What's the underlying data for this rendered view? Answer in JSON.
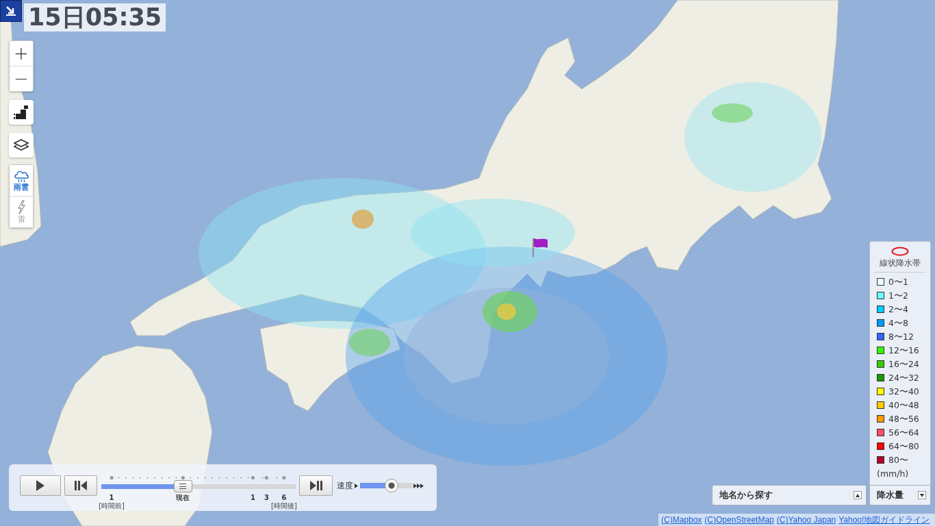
{
  "time_label": "15日05:35",
  "zoom": {
    "in": "+",
    "out": "−"
  },
  "modes": [
    {
      "kind": "rain",
      "label": "雨雲",
      "selected": true
    },
    {
      "kind": "lightning",
      "label": "雷",
      "selected": false
    }
  ],
  "player": {
    "timeline": {
      "level": 0.42,
      "marks": [
        {
          "label": "1",
          "caption": "[時間前]"
        },
        {
          "label": "現在"
        },
        {
          "label": "1"
        },
        {
          "label": "3"
        },
        {
          "label": "6",
          "caption": "[時間後]"
        }
      ]
    },
    "speed": {
      "label": "速度",
      "level": 0.6
    }
  },
  "legend": {
    "title": "線状降水帯",
    "items": [
      {
        "label": "0〜1",
        "color": "#e8ffff"
      },
      {
        "label": "1〜2",
        "color": "#66ffff"
      },
      {
        "label": "2〜4",
        "color": "#00ccff"
      },
      {
        "label": "4〜8",
        "color": "#0099ff"
      },
      {
        "label": "8〜12",
        "color": "#3366ff"
      },
      {
        "label": "12〜16",
        "color": "#33ff00"
      },
      {
        "label": "16〜24",
        "color": "#33cc00"
      },
      {
        "label": "24〜32",
        "color": "#199900"
      },
      {
        "label": "32〜40",
        "color": "#ffff00"
      },
      {
        "label": "40〜48",
        "color": "#ffcc00"
      },
      {
        "label": "48〜56",
        "color": "#ff9900"
      },
      {
        "label": "56〜64",
        "color": "#ff5066"
      },
      {
        "label": "64〜80",
        "color": "#ff0000"
      },
      {
        "label": "80〜",
        "color": "#b40028"
      }
    ],
    "unit": "(mm/h)"
  },
  "search": {
    "label": "地名から探す"
  },
  "layer_select": {
    "label": "降水量"
  },
  "attribution": [
    "(C)Mapbox",
    "(C)OpenStreetMap",
    "(C)Yahoo Japan",
    "Yahoo!地図ガイドライン"
  ]
}
